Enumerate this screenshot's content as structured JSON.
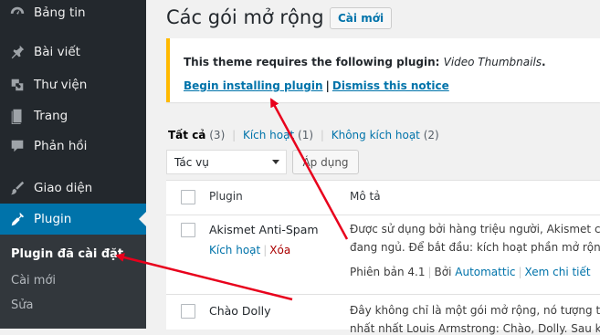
{
  "sidebar": {
    "items": [
      {
        "label": "Bảng tin",
        "icon": "dashboard-icon"
      },
      {
        "label": "Bài viết",
        "icon": "pin-icon"
      },
      {
        "label": "Thư viện",
        "icon": "media-icon"
      },
      {
        "label": "Trang",
        "icon": "page-icon"
      },
      {
        "label": "Phản hồi",
        "icon": "comment-icon"
      },
      {
        "label": "Giao diện",
        "icon": "brush-icon"
      },
      {
        "label": "Plugin",
        "icon": "plugin-icon"
      }
    ],
    "submenu": [
      "Plugin đã cài đặt",
      "Cài mới",
      "Sửa"
    ]
  },
  "header": {
    "title": "Các gói mở rộng",
    "add_new": "Cài mới"
  },
  "notice": {
    "message": "This theme requires the following plugin:",
    "plugin_name": "Video Thumbnails",
    "period": ".",
    "begin_link": "Begin installing plugin",
    "separator": "|",
    "dismiss_link": "Dismiss this notice"
  },
  "filters": {
    "all_label": "Tất cả",
    "all_count": "(3)",
    "active_label": "Kích hoạt",
    "active_count": "(1)",
    "inactive_label": "Không kích hoạt",
    "inactive_count": "(2)",
    "separator": "|"
  },
  "bulk": {
    "selected": "Tác vụ",
    "apply": "Áp dụng"
  },
  "table": {
    "col_plugin": "Plugin",
    "col_desc": "Mô tả",
    "rows": [
      {
        "name": "Akismet Anti-Spam",
        "action": "Kích hoạt",
        "delete": "Xóa",
        "desc1": "Được sử dụng bởi hàng triệu người, Akismet có",
        "desc2": "đang ngủ. Để bắt đầu: kích hoạt phần mở rộng",
        "version": "Phiên bản 4.1",
        "by": "Bởi",
        "author": "Automattic",
        "details": "Xem chi tiết"
      },
      {
        "name": "Chào Dolly",
        "desc1": "Đây không chỉ là một gói mở rộng, nó tượng trưng",
        "desc2": "nhất nhất Louis Armstrong: Chào, Dolly. Sau khi"
      }
    ]
  },
  "colors": {
    "accent": "#0073aa",
    "notice_border": "#ffb900",
    "arrow": "#e8001c"
  }
}
